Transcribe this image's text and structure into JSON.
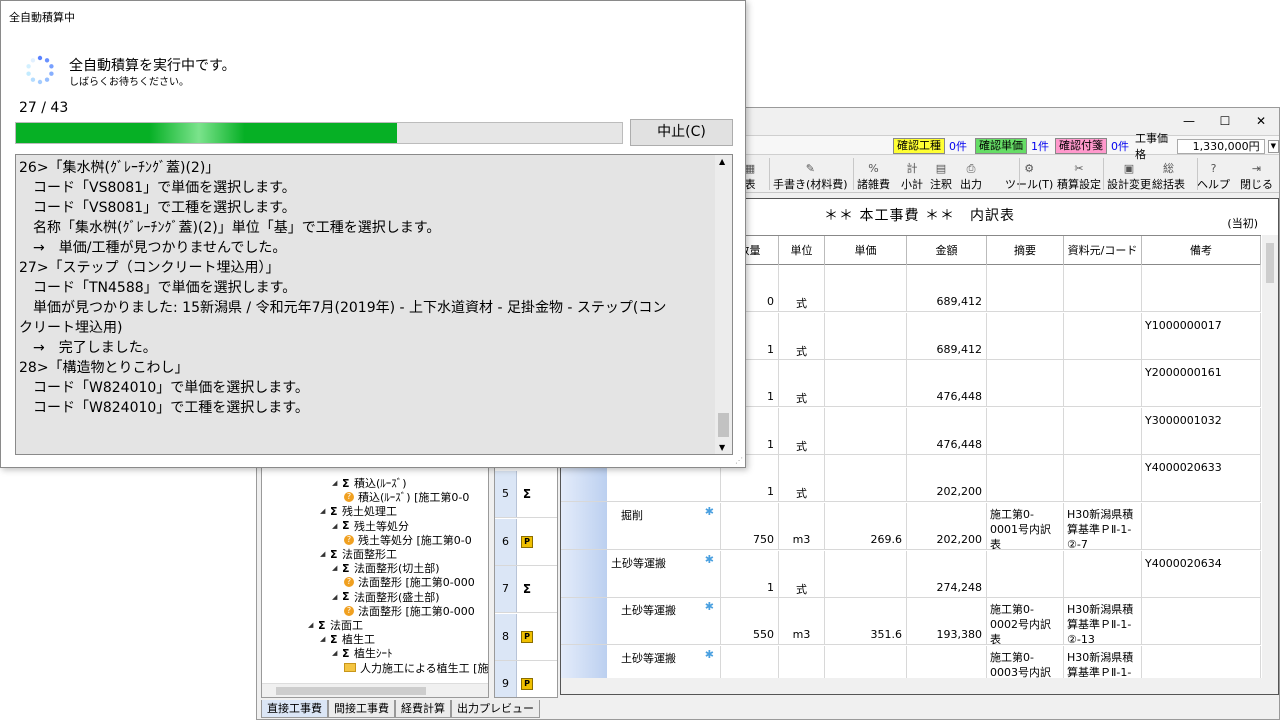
{
  "dialog": {
    "title": "全自動積算中",
    "message": "全自動積算を実行中です。",
    "submessage": "しばらくお待ちください。",
    "progress_text": "27 / 43",
    "progress_fraction": 0.628,
    "stop_label": "中止(C)",
    "log": [
      "26>「集水桝(ｸﾞﾚｰﾁﾝｸﾞ蓋)(2)」",
      "　コード「VS8081」で単価を選択します。",
      "　コード「VS8081」で工種を選択します。",
      "　名称「集水桝(ｸﾞﾚｰﾁﾝｸﾞ蓋)(2)」単位「基」で工種を選択します。",
      "　→　単価/工種が見つかりませんでした。",
      "27>「ステップ（コンクリート埋込用）」",
      "　コード「TN4588」で単価を選択します。",
      "　単価が見つかりました: 15新潟県 / 令和元年7月(2019年) - 上下水道資材 - 足掛金物 - ステップ(コン",
      "クリート埋込用)",
      "　→　完了しました。",
      "28>「構造物とりこわし」",
      "　コード「W824010」で単価を選択します。",
      "　コード「W824010」で工種を選択します。"
    ]
  },
  "window": {
    "minimize": "—",
    "maximize": "☐",
    "close": "✕"
  },
  "status": {
    "confirm_work_label": "確認工種",
    "confirm_work_count": "0件",
    "confirm_price_label": "確認単価",
    "confirm_price_count": "1件",
    "confirm_attach_label": "確認付箋",
    "confirm_attach_count": "0件",
    "price_label": "工事価格",
    "price_value": "1,330,000円"
  },
  "toolbar": [
    {
      "label": "表",
      "icon": "table-icon"
    },
    {
      "label": "手書き(材料費)",
      "icon": "pencil-icon"
    },
    {
      "label": "諸雑費",
      "icon": "percent-icon"
    },
    {
      "label": "小計",
      "icon": "subtotal-icon"
    },
    {
      "label": "注釈",
      "icon": "note-icon"
    },
    {
      "label": "出力",
      "icon": "printer-icon"
    },
    {
      "label": "ツール(T)",
      "icon": "gear-icon"
    },
    {
      "label": "積算設定",
      "icon": "settings-icon"
    },
    {
      "label": "設計変更",
      "icon": "design-change-icon"
    },
    {
      "label": "総括表",
      "icon": "summary-icon"
    },
    {
      "label": "ヘルプ",
      "icon": "help-icon"
    },
    {
      "label": "閉じる",
      "icon": "close-door-icon"
    }
  ],
  "sheet": {
    "title": "＊＊ 本工事費 ＊＊　内訳表",
    "subtitle": "(当初)",
    "headers": [
      "数量",
      "単位",
      "単価",
      "金額",
      "摘要",
      "資料元/コード",
      "備考"
    ],
    "rows": [
      {
        "num": "",
        "mark": "",
        "name": "",
        "qty": "0",
        "unit": "式",
        "price": "",
        "amount": "689,412",
        "note": "",
        "source": "",
        "remark": ""
      },
      {
        "num": "",
        "mark": "",
        "name": "",
        "qty": "1",
        "unit": "式",
        "price": "",
        "amount": "689,412",
        "note": "",
        "source": "",
        "remark": "Y1000000017"
      },
      {
        "num": "",
        "mark": "",
        "name": "",
        "qty": "1",
        "unit": "式",
        "price": "",
        "amount": "476,448",
        "note": "",
        "source": "",
        "remark": "Y2000000161"
      },
      {
        "num": "",
        "mark": "",
        "name": "",
        "qty": "1",
        "unit": "式",
        "price": "",
        "amount": "476,448",
        "note": "",
        "source": "",
        "remark": "Y3000001032"
      },
      {
        "num": "5",
        "mark": "Σ",
        "name": "",
        "qty": "1",
        "unit": "式",
        "price": "",
        "amount": "202,200",
        "note": "",
        "source": "",
        "remark": "Y4000020633"
      },
      {
        "num": "6",
        "mark": "P",
        "name": "掘削",
        "qty": "750",
        "unit": "m3",
        "price": "269.6",
        "amount": "202,200",
        "note": "施工第0-0001号内訳表",
        "source": "H30新潟県積算基準ＰⅡ-1-②-7",
        "remark": ""
      },
      {
        "num": "7",
        "mark": "Σ",
        "name": "土砂等運搬",
        "qty": "1",
        "unit": "式",
        "price": "",
        "amount": "274,248",
        "note": "",
        "source": "",
        "remark": "Y4000020634"
      },
      {
        "num": "8",
        "mark": "P",
        "name": "土砂等運搬",
        "qty": "550",
        "unit": "m3",
        "price": "351.6",
        "amount": "193,380",
        "note": "施工第0-0002号内訳表",
        "source": "H30新潟県積算基準ＰⅡ-1-②-13",
        "remark": ""
      },
      {
        "num": "9",
        "mark": "P",
        "name": "土砂等運搬",
        "qty": "",
        "unit": "",
        "price": "",
        "amount": "",
        "note": "施工第0-0003号内訳表",
        "source": "H30新潟県積算基準ＰⅡ-1-",
        "remark": ""
      }
    ]
  },
  "tree": [
    {
      "level": 2,
      "type": "sigma",
      "label": "積込(ﾙｰｽﾞ)"
    },
    {
      "level": 3,
      "type": "q",
      "label": "積込(ﾙｰｽﾞ) [施工第0-0"
    },
    {
      "level": 1,
      "type": "sigma",
      "label": "残土処理工"
    },
    {
      "level": 2,
      "type": "sigma",
      "label": "残土等処分"
    },
    {
      "level": 3,
      "type": "q",
      "label": "残土等処分 [施工第0-0"
    },
    {
      "level": 1,
      "type": "sigma",
      "label": "法面整形工"
    },
    {
      "level": 2,
      "type": "sigma",
      "label": "法面整形(切土部)"
    },
    {
      "level": 3,
      "type": "q",
      "label": "法面整形 [施工第0-000"
    },
    {
      "level": 2,
      "type": "sigma",
      "label": "法面整形(盛土部)"
    },
    {
      "level": 3,
      "type": "q",
      "label": "法面整形 [施工第0-000"
    },
    {
      "level": 0,
      "type": "sigma",
      "label": "法面工"
    },
    {
      "level": 1,
      "type": "sigma",
      "label": "植生工"
    },
    {
      "level": 2,
      "type": "sigma",
      "label": "植生ｼｰﾄ"
    },
    {
      "level": 3,
      "type": "folder",
      "label": "人力施工による植生工 [施"
    }
  ],
  "bottom_tabs": [
    "直接工事費",
    "間接工事費",
    "経費計算",
    "出力プレビュー"
  ]
}
